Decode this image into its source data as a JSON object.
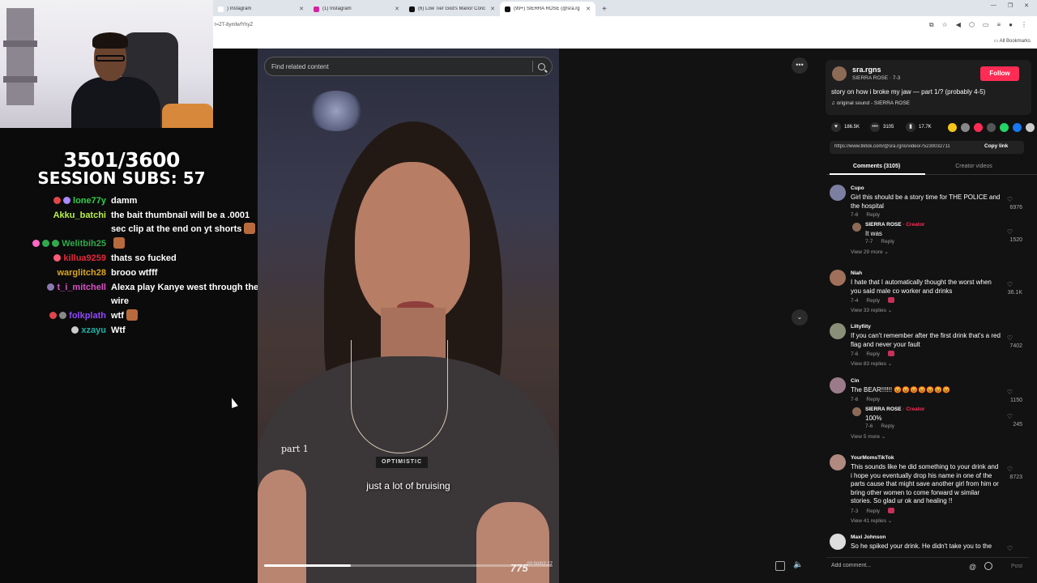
{
  "browser": {
    "tabs": [
      {
        "title": ") Instagram",
        "color": "#ffffff",
        "active": false
      },
      {
        "title": "(1) Instagram",
        "color": "#d6249f",
        "active": false
      },
      {
        "title": "(6) Low Tier God's Manor Conc",
        "color": "#111111",
        "active": false
      },
      {
        "title": "(99+) SIERRA ROSE (@sra.rg",
        "color": "#111111",
        "active": true
      }
    ],
    "new_tab": "+",
    "url": "t=ZT-8ymfwfYhyZ",
    "all_bookmarks": "All Bookmarks"
  },
  "overlay": {
    "sub_goal": "3501/3600",
    "session_subs": "SESSION SUBS: 57"
  },
  "chat": [
    {
      "user": "lone77y",
      "color": "#2fcf4a",
      "text": "damm",
      "badges": [
        "#e0454a",
        "#a98aff"
      ]
    },
    {
      "user": "Akku_batchi",
      "color": "#b7f04a",
      "text": "the bait thumbnail will be a .0001 sec clip at the end on yt shorts",
      "badges": []
    },
    {
      "user": "Welitbih25",
      "color": "#2fa94a",
      "text": "",
      "badges": [
        "#ff67c8",
        "#2fa94a",
        "#2fa94a"
      ]
    },
    {
      "user": "killua9259",
      "color": "#e0283a",
      "text": "thats so fucked",
      "badges": [
        "#ff5a7a"
      ]
    },
    {
      "user": "warglitch28",
      "color": "#daa520",
      "text": "brooo wtfff",
      "badges": []
    },
    {
      "user": "t_i_mitchell",
      "color": "#d94fc8",
      "text": "Alexa play Kanye west through the wire",
      "badges": [
        "#8a7ab0"
      ]
    },
    {
      "user": "folkplath",
      "color": "#9146ff",
      "text": "wtf",
      "badges": [
        "#e0454a",
        "#888888"
      ]
    },
    {
      "user": "xzayu",
      "color": "#1fb0a5",
      "text": "Wtf",
      "badges": [
        "#cccccc"
      ]
    }
  ],
  "search": {
    "placeholder": "Find related content"
  },
  "video": {
    "part_label": "part 1",
    "shirt_text": "OPTIMISTIC",
    "caption": "just a lot of bruising",
    "time": "00:50/02:27",
    "watermark": "775",
    "progress": 0.3
  },
  "creator": {
    "handle": "sra.rgns",
    "name": "SIERRA ROSE · 7-3",
    "follow": "Follow",
    "description": "story on how i broke my jaw — part 1/? (probably 4-5)",
    "sound": "original sound - SIERRA ROSE"
  },
  "stats": {
    "likes": "186.5K",
    "comments": "3105",
    "saves": "17.7K"
  },
  "share_colors": [
    "#f5c518",
    "#888888",
    "#fe2c55",
    "#555555",
    "#25d366",
    "#1877f2",
    "#cccccc"
  ],
  "link": {
    "url": "https://www.tiktok.com/@sra.rgns/video/75230032711",
    "copy": "Copy link"
  },
  "tabs": {
    "comments": "Comments (3105)",
    "creator_videos": "Creator videos"
  },
  "comments": [
    {
      "user": "Cupo",
      "avatar": "#7c7fa0",
      "text": "Girl this should be a story time for THE POLICE and the hospital",
      "date": "7-6",
      "reply": "Reply",
      "likes": "6976",
      "creator_liked": false,
      "more": "View 29 more ⌄",
      "sub": {
        "user": "SIERRA ROSE",
        "tag": " · Creator",
        "text": "It was",
        "date": "7-7",
        "reply": "Reply",
        "likes": "1520"
      }
    },
    {
      "user": "Niah",
      "avatar": "#a0705a",
      "text": "I hate that I automatically thought the worst when you said male co worker and drinks",
      "date": "7-4",
      "reply": "Reply",
      "likes": "36.1K",
      "creator_liked": true,
      "more": "View 33 replies ⌄"
    },
    {
      "user": "Liltyfiity",
      "avatar": "#8a8f7a",
      "text": "If you can't remember after the first drink that's a red flag and never your fault",
      "date": "7-6",
      "reply": "Reply",
      "likes": "7402",
      "creator_liked": true,
      "more": "View 83 replies ⌄"
    },
    {
      "user": "Cin",
      "avatar": "#9b7b8a",
      "text": "The BEAR!!!!!! 😡😡😡😡😡😡😡",
      "date": "7-6",
      "reply": "Reply",
      "likes": "1150",
      "creator_liked": false,
      "more": "View 5 more ⌄",
      "sub": {
        "user": "SIERRA ROSE",
        "tag": " · Creator",
        "text": "100%",
        "date": "7-6",
        "reply": "Reply",
        "likes": "245"
      }
    },
    {
      "user": "YourMomsTikTok",
      "avatar": "#b08a80",
      "text": "This sounds like he did something to your drink and i hope you eventually drop his name in one of the parts cause that might save another girl from him or bring other women to come forward w similar stories. So glad ur ok and healing !!",
      "date": "7-3",
      "reply": "Reply",
      "likes": "8723",
      "creator_liked": true,
      "more": "View 41 replies ⌄"
    },
    {
      "user": "Maxi Johnson",
      "avatar": "#dddddd",
      "text": "So he spiked your drink. He didn't take you to the",
      "date": "",
      "reply": "",
      "likes": "",
      "creator_liked": false,
      "more": ""
    }
  ],
  "add_comment": {
    "placeholder": "Add comment...",
    "post": "Post"
  }
}
